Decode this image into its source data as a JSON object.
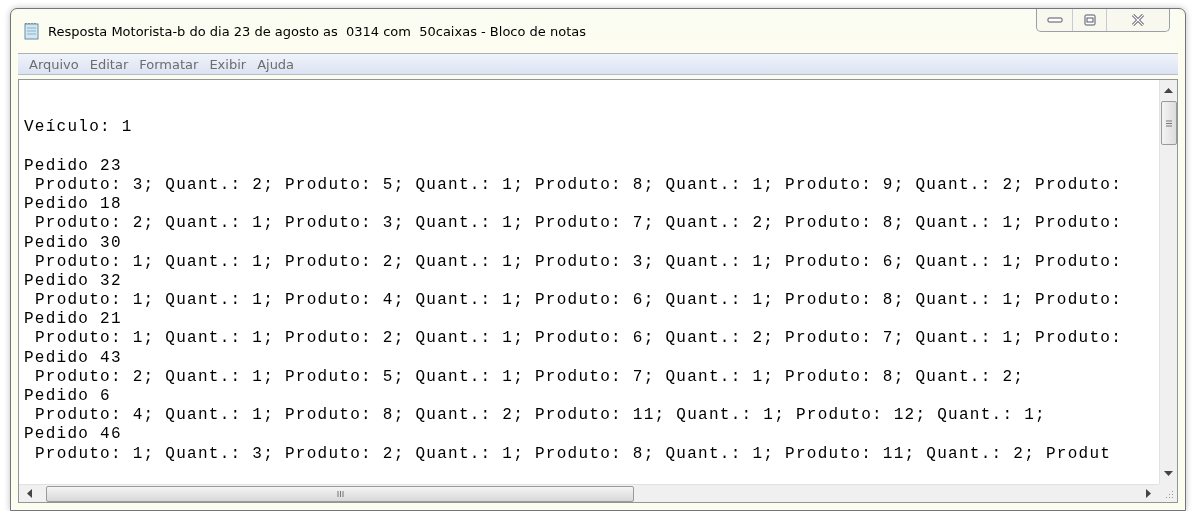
{
  "window": {
    "title": "Resposta Motorista-b do dia 23 de agosto as  0314 com  50caixas - Bloco de notas"
  },
  "menu": [
    "Arquivo",
    "Editar",
    "Formatar",
    "Exibir",
    "Ajuda"
  ],
  "document": {
    "vehicle": "Veículo: 1",
    "orders": [
      {
        "heading": "Pedido 23",
        "items": "Produto: 3; Quant.: 2; Produto: 5; Quant.: 1; Produto: 8; Quant.: 1; Produto: 9; Quant.: 2; Produto:"
      },
      {
        "heading": "Pedido 18",
        "items": "Produto: 2; Quant.: 1; Produto: 3; Quant.: 1; Produto: 7; Quant.: 2; Produto: 8; Quant.: 1; Produto:"
      },
      {
        "heading": "Pedido 30",
        "items": "Produto: 1; Quant.: 1; Produto: 2; Quant.: 1; Produto: 3; Quant.: 1; Produto: 6; Quant.: 1; Produto:"
      },
      {
        "heading": "Pedido 32",
        "items": "Produto: 1; Quant.: 1; Produto: 4; Quant.: 1; Produto: 6; Quant.: 1; Produto: 8; Quant.: 1; Produto:"
      },
      {
        "heading": "Pedido 21",
        "items": "Produto: 1; Quant.: 1; Produto: 2; Quant.: 1; Produto: 6; Quant.: 2; Produto: 7; Quant.: 1; Produto:"
      },
      {
        "heading": "Pedido 43",
        "items": "Produto: 2; Quant.: 1; Produto: 5; Quant.: 1; Produto: 7; Quant.: 1; Produto: 8; Quant.: 2;"
      },
      {
        "heading": "Pedido 6",
        "items": "Produto: 4; Quant.: 1; Produto: 8; Quant.: 2; Produto: 11; Quant.: 1; Produto: 12; Quant.: 1;"
      },
      {
        "heading": "Pedido 46",
        "items": "Produto: 1; Quant.: 3; Produto: 2; Quant.: 1; Produto: 8; Quant.: 1; Produto: 11; Quant.: 2; Produt"
      }
    ]
  }
}
